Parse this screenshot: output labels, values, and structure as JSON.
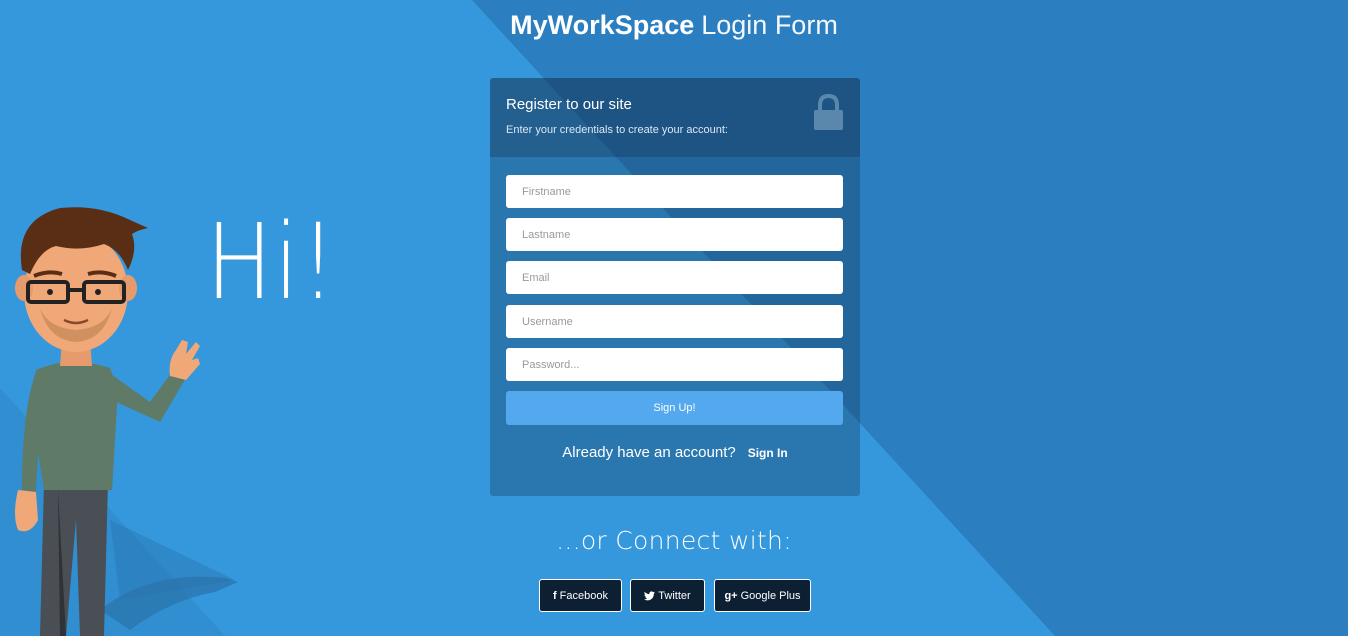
{
  "page": {
    "brand": "MyWorkSpace",
    "subtitle": "Login Form",
    "greeting": "Hi!"
  },
  "form": {
    "heading": "Register to our site",
    "description": "Enter your credentials to create your account:",
    "fields": [
      {
        "name": "firstname",
        "placeholder": "Firstname",
        "value": ""
      },
      {
        "name": "lastname",
        "placeholder": "Lastname",
        "value": ""
      },
      {
        "name": "email",
        "placeholder": "Email",
        "value": ""
      },
      {
        "name": "username",
        "placeholder": "Username",
        "value": ""
      },
      {
        "name": "password",
        "placeholder": "Password...",
        "value": ""
      }
    ],
    "signup_label": "Sign Up!",
    "account_prompt": "Already have an account?",
    "signin_label": "Sign In"
  },
  "connect": {
    "title": "...or Connect with:",
    "buttons": [
      {
        "icon": "facebook-icon",
        "glyph": "f",
        "label": "Facebook"
      },
      {
        "icon": "twitter-icon",
        "glyph": "🐦",
        "label": "Twitter"
      },
      {
        "icon": "google-plus-icon",
        "glyph": "g+",
        "label": "Google Plus"
      }
    ]
  },
  "colors": {
    "background": "#3598dc",
    "background_dark": "#2b7fc0",
    "button_primary": "#53a8ee",
    "social_button": "#0d1f33"
  }
}
